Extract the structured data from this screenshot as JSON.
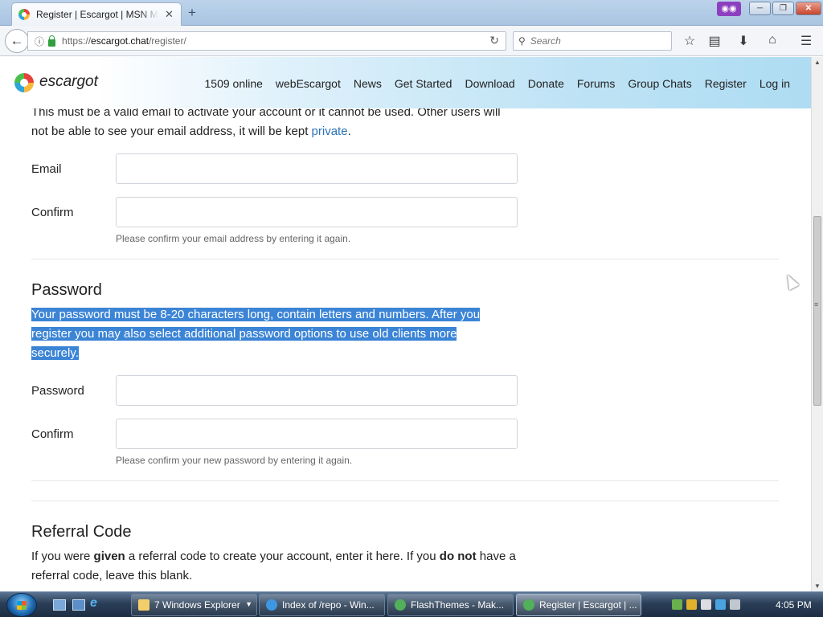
{
  "browser": {
    "tab_title": "Register | Escargot | MSN Me",
    "tab_close": "✕",
    "new_tab": "+",
    "private_icon": "private-browsing-mask",
    "url_scheme": "https://",
    "url_host": "escargot.chat",
    "url_path": "/register/",
    "search_placeholder": "Search",
    "icons": [
      "back-arrow",
      "info",
      "lock",
      "reload",
      "search",
      "bookmark-star",
      "reading-list",
      "download",
      "home",
      "menu"
    ]
  },
  "site": {
    "name": "escargot",
    "nav": [
      "1509 online",
      "webEscargot",
      "News",
      "Get Started",
      "Download",
      "Donate",
      "Forums",
      "Group Chats",
      "Register",
      "Log in"
    ]
  },
  "form": {
    "email_intro_a": "This must be a valid email to activate your account or it cannot be used. Other users will not be able to see your email address, it will be kept ",
    "email_intro_link": "private",
    "email_intro_end": ".",
    "email_label": "Email",
    "email_confirm_label": "Confirm",
    "email_help": "Please confirm your email address by entering it again.",
    "password_heading": "Password",
    "password_intro_line1": "Your password must be 8-20 characters long, contain letters and numbers. After you",
    "password_intro_line2": "register you may also select additional password options to use old clients more",
    "password_intro_line3": "securely.",
    "password_label": "Password",
    "password_confirm_label": "Confirm",
    "password_help": "Please confirm your new password by entering it again.",
    "referral_heading": "Referral Code",
    "referral_intro_a": "If you were ",
    "referral_intro_b": "given",
    "referral_intro_c": " a referral code to create your account, enter it here. If you ",
    "referral_intro_d": "do not",
    "referral_intro_e": " have a referral code, leave this blank."
  },
  "taskbar": {
    "tasks": [
      {
        "label": "7 Windows Explorer"
      },
      {
        "label": "Index of /repo - Win..."
      },
      {
        "label": "FlashThemes - Mak..."
      },
      {
        "label": "Register | Escargot | ..."
      }
    ],
    "clock": "4:05 PM"
  },
  "colors": {
    "link": "#2a73b8",
    "selection": "#3b84d6",
    "header_gradient_end": "#aedcf2"
  }
}
